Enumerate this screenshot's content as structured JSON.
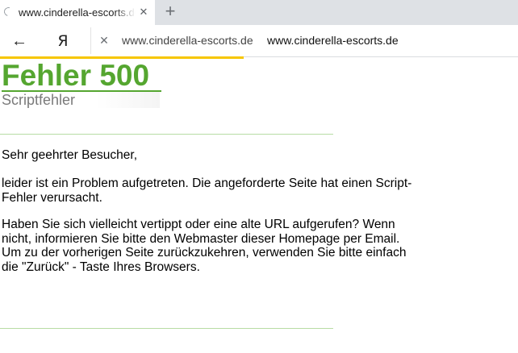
{
  "browser": {
    "tab": {
      "title": "www.cinderella-escorts.de",
      "close_glyph": "✕"
    },
    "new_tab_glyph": "+",
    "toolbar": {
      "back_glyph": "←",
      "yandex_glyph": "Я",
      "clear_glyph": "✕",
      "host": "www.cinderella-escorts.de",
      "address_value": "www.cinderella-escorts.de"
    },
    "icons": {
      "loading": "loading-spinner-icon",
      "back": "arrow-left-icon",
      "yandex": "yandex-logo-icon",
      "close": "close-icon",
      "new_tab": "plus-icon"
    },
    "colors": {
      "loading_bar": "#f7c600",
      "title_green": "#55a630",
      "rule_green": "#b8dca4"
    }
  },
  "page": {
    "title": "Fehler 500",
    "subtitle": "Scriptfehler",
    "greeting": "Sehr geehrter Besucher,",
    "paragraph1": "leider ist ein Problem aufgetreten. Die angeforderte Seite hat einen Script-Fehler verursacht.",
    "paragraph2": "Haben Sie sich vielleicht vertippt oder eine alte URL aufgerufen? Wenn nicht, informieren Sie bitte den Webmaster dieser Homepage per Email. Um zu der vorherigen Seite zurückzukehren, verwenden Sie bitte einfach die \"Zurück\" - Taste Ihres Browsers."
  }
}
